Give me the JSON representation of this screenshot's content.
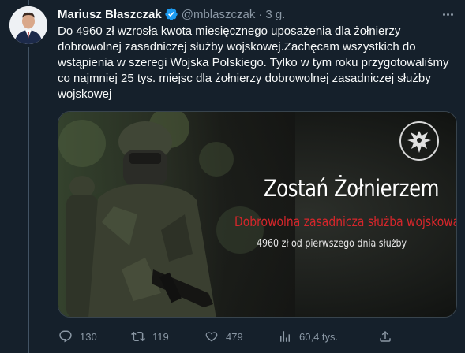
{
  "tweet": {
    "author_name": "Mariusz Błaszczak",
    "author_handle": "@mblaszczak",
    "separator": "·",
    "time": "3 g.",
    "text": "Do 4960 zł wzrosła kwota miesięcznego uposażenia dla żołnierzy dobrowolnej zasadniczej służby wojskowej.Zachęcam wszystkich do wstąpienia w szeregi Wojska Polskiego. Tylko w tym roku przygotowaliśmy co najmniej 25 tys. miejsc dla żołnierzy dobrowolnej zasadniczej służby wojskowej"
  },
  "media": {
    "title": "Zostań Żołnierzem",
    "subtitle": "Dobrowolna zasadnicza służba wojskowa",
    "caption": "4960 zł od pierwszego dnia służby"
  },
  "actions": {
    "replies": "130",
    "retweets": "119",
    "likes": "479",
    "views": "60,4 tys."
  },
  "colors": {
    "background": "#15202b",
    "text": "#f7f9f9",
    "secondary": "#8b98a5",
    "verified": "#1d9bf0",
    "accent_red": "#d6262b"
  },
  "icons": [
    "more-icon",
    "verified-badge-icon",
    "reply-icon",
    "retweet-icon",
    "like-icon",
    "views-icon",
    "share-icon",
    "army-eagle-emblem"
  ]
}
